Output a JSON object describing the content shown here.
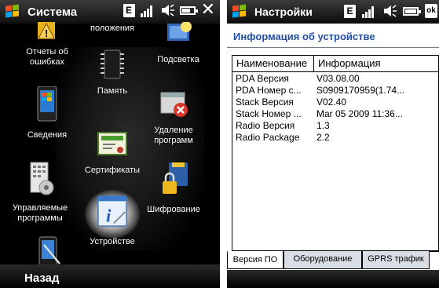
{
  "left_panel": {
    "title": "Система",
    "status": {
      "e_badge": "E"
    },
    "tiles": [
      {
        "label": "положения",
        "icon": "settings-partial-icon"
      },
      {
        "label": "Отчеты об\nошибках",
        "icon": "warning-icon"
      },
      {
        "label": "Память",
        "icon": "memory-chip-icon"
      },
      {
        "label": "Подсветка",
        "icon": "backlight-bulb-icon"
      },
      {
        "label": "Сведения",
        "icon": "windows-info-icon"
      },
      {
        "label": "Удаление\nпрограмм",
        "icon": "remove-programs-icon"
      },
      {
        "label": "Сертификаты",
        "icon": "certificate-icon"
      },
      {
        "label": "Управляемые\nпрограммы",
        "icon": "managed-programs-icon"
      },
      {
        "label": "Шифрование",
        "icon": "encryption-card-icon"
      },
      {
        "label": "Устройстве",
        "icon": "device-info-icon"
      },
      {
        "label": "",
        "icon": "pda-stylus-icon"
      }
    ],
    "back_label": "Назад"
  },
  "right_panel": {
    "title": "Настройки",
    "status": {
      "e_badge": "E",
      "ok_label": "ok"
    },
    "heading": "Информация об устройстве",
    "table": {
      "headers": [
        "Наименование",
        "Информация"
      ],
      "rows": [
        [
          "PDA Версия",
          "V03.08.00"
        ],
        [
          "PDA Номер с...",
          "S0909170959(1.74..."
        ],
        [
          "Stack Версия",
          "V02.40"
        ],
        [
          "Stack Номер ...",
          "Mar 05 2009 11:36..."
        ],
        [
          "Radio Версия",
          "1.3"
        ],
        [
          "Radio Package",
          "2.2"
        ]
      ]
    },
    "tabs": [
      "Версия ПО",
      "Оборудование",
      "GPRS трафик"
    ]
  },
  "colors": {
    "heading": "#2150a8",
    "tab_inactive": "#d9dde4"
  }
}
